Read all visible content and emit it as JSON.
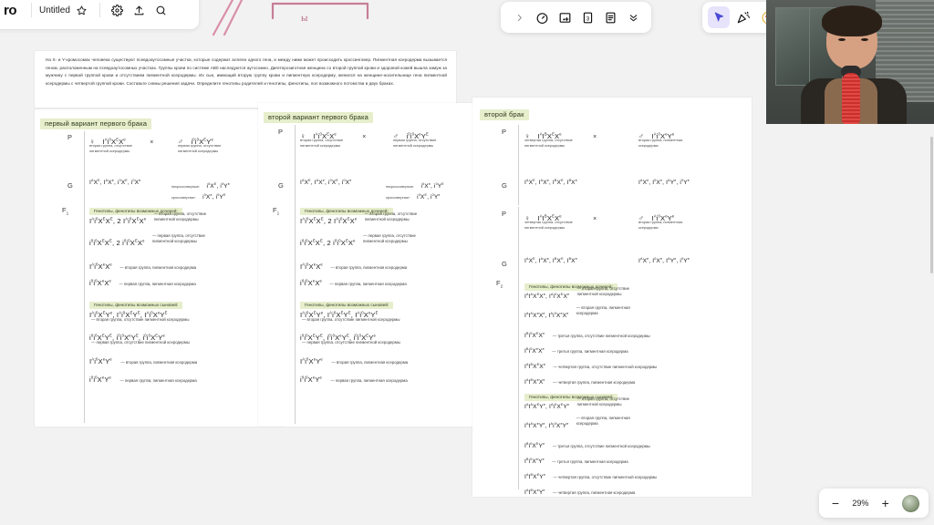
{
  "app": {
    "brand": "ro",
    "doc_title": "Untitled",
    "zoom_level": "29%",
    "icons": {
      "star": "star-icon",
      "gear": "gear-icon",
      "upload": "upload-icon",
      "search": "search-icon",
      "chevron_right": "chevron-right-icon",
      "timer": "timer-icon",
      "frame": "frame-icon",
      "number_three": "3",
      "notes": "notes-icon",
      "chevron_double_down": "chevron-double-down-icon",
      "cursor": "cursor-icon",
      "party": "party-popper-icon",
      "ai": "ai-magic-icon",
      "minus": "−",
      "plus": "+"
    }
  },
  "ink": {
    "bracket_label": "ы"
  },
  "problem": {
    "text": "На X- и Y-хромосомах человека существуют псевдоаутосомные участки, которые содержат аллели одного гена, и между ними может происходить кроссинговер. Пигментная ксеродерма вызывается геном, расположенным на псевдоаутосомных участках. Группы крови по системе АВ0 наследуются аутосомно. Дигетерозиготная женщина со второй группой крови и здоровой кожей вышла замуж за мужчину с первой группой крови и отсутствием пигментной ксеродермы. Их сын, имеющий вторую группу крови и пигментную ксеродерму, женился на женщине-носительнице гена пигментной ксеродермы с четвертой группой крови. Составьте схемы решения задачи. Определите генотипы родителей и генотипы, фенотипы, пол возможного потомства в двух браках."
  },
  "labels": {
    "P": "P",
    "G": "G",
    "F1": "F",
    "F1sub": "1",
    "F2": "F",
    "F2sub": "2",
    "cross": "×",
    "female": "♀",
    "male": "♂",
    "daughters_heading": "Генотипы, фенотипы возможных дочерей:",
    "sons_heading": "Генотипы, фенотипы возможных сыновей:",
    "noncrossover": "некроссоверные:",
    "crossover": "кроссоверные:"
  },
  "col1": {
    "heading": "первый вариант первого брака",
    "p_female_genotype": "I^A i^0 X^E X^e",
    "p_female_pheno": "вторая группа, отсутствие пигментной ксеродермы",
    "p_male_genotype": "i^0 i^0 X^E Y^e",
    "p_male_pheno": "первая группа, отсутствие пигментной ксеродермы",
    "g_female": "I^A X^E , I^A X^e , i^0 X^E , i^0 X^e",
    "g_male_noncross": "i^0 X^E , i^0 Y^e",
    "g_male_cross": "i^0 X^e , i^0 Y^E",
    "daughters": [
      {
        "genotype": "I^A i^0 X^E X^E , 2 I^A i^0 X^E X^e",
        "pheno": "вторая группа, отсутствие пигментной ксеродермы"
      },
      {
        "genotype": "i^0 i^0 X^E X^E , 2 i^0 i^0 X^E X^e",
        "pheno": "первая группа, отсутствие пигментной ксеродермы"
      },
      {
        "genotype": "I^A i^0 X^e X^e",
        "pheno": "вторая группа, пигментная ксеродерма"
      },
      {
        "genotype": "i^0 i^0 X^e X^e",
        "pheno": "первая группа, пигментная ксеродерма"
      }
    ],
    "sons": [
      {
        "genotype": "I^A i^0 X^E Y^e , I^A i^0 X^E Y^E , I^A i^0 X^e Y^E",
        "pheno": "— вторая группа, отсутствие пигментной ксеродермы"
      },
      {
        "genotype": "i^0 i^0 X^E Y^E , i^0 i^0 X^e Y^E , i^0 i^0 X^E Y^e",
        "pheno": "— первая группа, отсутствие пигментной ксеродермы"
      },
      {
        "genotype": "I^A i^0 X^e Y^e",
        "pheno": "— вторая группа, пигментная ксеродерма"
      },
      {
        "genotype": "i^0 i^0 X^e Y^e",
        "pheno": "— первая группа, пигментная ксеродерма"
      }
    ]
  },
  "col2": {
    "heading": "второй вариант первого брака",
    "p_female_genotype": "I^A i^0 X^E X^e",
    "p_female_pheno": "вторая группа, отсутствие пигментной ксеродермы",
    "p_male_genotype": "i^0 i^0 X^e Y^E",
    "p_male_pheno": "первая группа, отсутствие пигментной ксеродермы",
    "g_female": "I^A X^E , I^A X^e , i^0 X^E , i^0 X^e",
    "g_male_noncross": "i^0 X^e , i^0 Y^E",
    "g_male_cross": "i^0 X^E , i^0 Y^e",
    "daughters": [
      {
        "genotype": "I^A i^0 X^E X^E , 2 I^A i^0 X^E X^e",
        "pheno": "вторая группа, отсутствие пигментной ксеродермы"
      },
      {
        "genotype": "i^0 i^0 X^E X^E , 2 i^0 i^0 X^E X^e",
        "pheno": "первая группа, отсутствие пигментной ксеродермы"
      },
      {
        "genotype": "I^A i^0 X^e X^e",
        "pheno": "вторая группа, пигментная ксеродерма"
      },
      {
        "genotype": "i^0 i^0 X^e X^e",
        "pheno": "первая группа, пигментная ксеродерма"
      }
    ],
    "sons": [
      {
        "genotype": "I^A i^0 X^E Y^e , I^A i^0 X^E Y^E , I^A i^0 X^e Y^E",
        "pheno": "— вторая группа, отсутствие пигментной ксеродермы"
      },
      {
        "genotype": "i^0 i^0 X^E Y^E , i^0 i^0 X^e Y^E , i^0 i^0 X^E Y^e",
        "pheno": "— первая группа, отсутствие пигментной ксеродермы"
      },
      {
        "genotype": "I^A i^0 X^e Y^e",
        "pheno": "— вторая группа, пигментная ксеродерма"
      },
      {
        "genotype": "i^0 i^0 X^e Y^e",
        "pheno": "— первая группа, пигментная ксеродерма"
      }
    ]
  },
  "col3": {
    "heading": "второй брак",
    "p_female_genotype": "I^A I^B X^E X^e",
    "p_female_pheno": "четвертая группа, отсутствие пигментной ксеродермы",
    "p_male_genotype": "I^A i^0 X^e Y^e",
    "p_male_pheno": "вторая группа, пигментная ксеродерма",
    "g_female": "I^A X^E , I^A X^e , I^B X^E , I^B X^e",
    "g_male": "I^A X^e , I^0 X^e , I^A Y^e , i^0 Y^e",
    "p2_female_genotype": "I^A I^B X^E X^e",
    "p2_female_pheno": "четвертая группа, отсутствие пигментной ксеродермы",
    "p2_male_genotype": "I^A i^0 X^e Y^e",
    "p2_male_pheno": "вторая группа, пигментная ксеродерма",
    "g2_female": "I^A X^E , I^A X^e , I^B X^E , I^B X^e",
    "g2_male": "I^A X^e , I^0 X^e , I^A Y^e , i^0 Y^e",
    "daughters": [
      {
        "genotype": "I^A I^A X^E X^e , I^A i^0 X^E X^e",
        "pheno": "вторая группа, отсутствие пигментной ксеродермы"
      },
      {
        "genotype": "I^A I^A X^e X^e , I^A i^0 X^e X^e",
        "pheno": "вторая группа, пигментная ксеродерма"
      },
      {
        "genotype": "I^B i^0 X^E X^e",
        "pheno": "третья группа, отсутствие пигментной ксеродермы"
      },
      {
        "genotype": "I^B i^0 X^e X^e",
        "pheno": "третья группа, пигментная ксеродерма"
      },
      {
        "genotype": "I^A I^B X^E X^e",
        "pheno": "четвертая группа, отсутствие пигментной ксеродермы"
      },
      {
        "genotype": "I^A I^B X^e X^e",
        "pheno": "четвертая группа, пигментная ксеродерма"
      }
    ],
    "sons": [
      {
        "genotype": "I^A I^A X^E Y^e , I^A i^0 X^E Y^e",
        "pheno": "вторая группа, отсутствие пигментной ксеродермы"
      },
      {
        "genotype": "I^A I^A X^e Y^e , I^A i^0 X^e Y^e",
        "pheno": "вторая группа, пигментная ксеродерма"
      },
      {
        "genotype": "I^B i^0 X^E Y^e",
        "pheno": "третья группа, отсутствие пигментной ксеродермы"
      },
      {
        "genotype": "I^B i^0 X^e Y^e",
        "pheno": "третья группа, пигментная ксеродерма"
      },
      {
        "genotype": "I^A I^B X^E Y^e",
        "pheno": "четвертая группа, отсутствие пигментной ксеродермы"
      },
      {
        "genotype": "I^A I^B X^e Y^e",
        "pheno": "четвертая группа, пигментная ксеродерма"
      }
    ]
  }
}
